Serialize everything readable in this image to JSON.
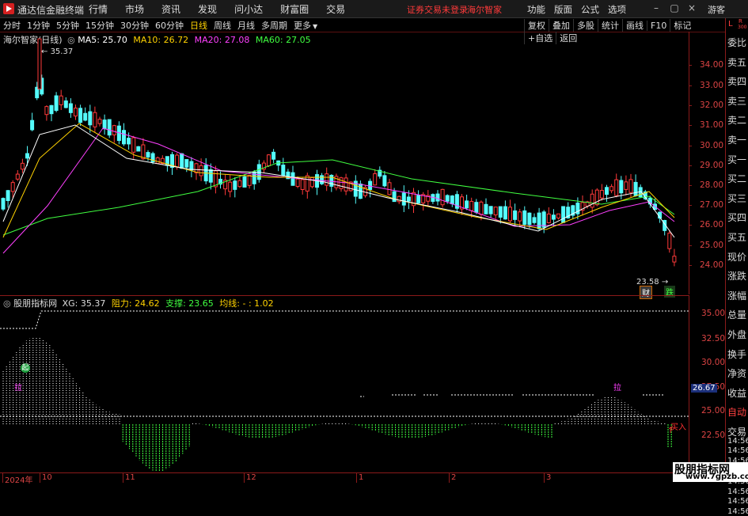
{
  "titlebar": {
    "app_name": "通达信金融终端",
    "menu": [
      "行情",
      "市场",
      "资讯",
      "发现",
      "问小达",
      "财富圈",
      "交易"
    ],
    "notice": "证券交易未登录",
    "stock_name": "海尔智家",
    "right_menu": [
      "功能",
      "版面",
      "公式",
      "选项"
    ],
    "guest": "游客",
    "window_buttons": [
      "minimize-icon",
      "maximize-icon",
      "close-icon"
    ]
  },
  "toolbar": {
    "periods": [
      "分时",
      "1分钟",
      "5分钟",
      "15分钟",
      "30分钟",
      "60分钟",
      "日线",
      "周线",
      "月线",
      "多周期",
      "更多"
    ],
    "active_period": "日线",
    "tools": [
      "复权",
      "叠加",
      "多股",
      "统计",
      "画线",
      "F10",
      "标记",
      "+自选",
      "返回"
    ]
  },
  "main_legend": {
    "title": "海尔智家(日线)",
    "ma5": "MA5: 25.70",
    "ma10": "MA10: 26.72",
    "ma20": "MA20: 27.08",
    "ma60": "MA60: 27.05",
    "colors": {
      "ma5": "#ffffff",
      "ma10": "#ffd200",
      "ma20": "#ff40ff",
      "ma60": "#40ff40"
    }
  },
  "main_annotations": {
    "high_label": "35.37",
    "low_label": "23.58",
    "badge_cai": "财",
    "badge_die": "跌"
  },
  "price_axis": [
    "34.00",
    "33.00",
    "32.00",
    "31.00",
    "30.00",
    "29.00",
    "28.00",
    "27.00",
    "26.00",
    "25.00",
    "24.00"
  ],
  "indicator_legend": {
    "name": "股朋指标网",
    "xg": "XG: 35.37",
    "zuli": "阻力: 24.62",
    "zhicheng": "支撑: 23.65",
    "junxian": "均线: - : 1.02"
  },
  "indicator_annotations": {
    "qi": "起",
    "la1": "拉",
    "la2": "拉",
    "mairu": "买入"
  },
  "indicator_axis": [
    "35.00",
    "32.50",
    "30.00",
    "27.50",
    "25.00",
    "22.50"
  ],
  "indicator_current": "26.67",
  "time_axis": [
    "2024年",
    "10",
    "11",
    "12",
    "1",
    "2",
    "3"
  ],
  "side_panel": {
    "top": [
      "L",
      "R",
      "300"
    ],
    "labels": [
      "委比",
      "卖五",
      "卖四",
      "卖三",
      "卖二",
      "卖一",
      "买一",
      "买二",
      "买三",
      "买四",
      "买五",
      "现价",
      "涨跌",
      "涨幅",
      "总量",
      "外盘",
      "换手",
      "净资",
      "收益",
      "自动",
      "交易",
      "14:56",
      "14:56",
      "14:56",
      "14:56",
      "14:56",
      "14:56",
      "14:56",
      "14:56"
    ]
  },
  "watermark": {
    "line1": "股朋指标网",
    "line2": "www.7gpzb.com"
  }
}
